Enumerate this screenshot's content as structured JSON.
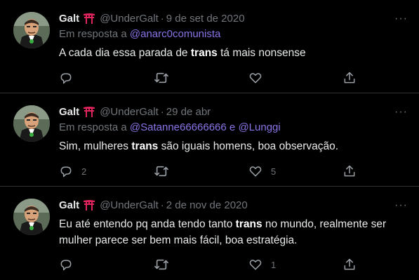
{
  "colors": {
    "background": "#000000",
    "mention": "#8b74e6",
    "muted": "#71767b",
    "text": "#e7e9ea",
    "torii": "#e0245e"
  },
  "icons": [
    "torii-gate-icon",
    "reply-icon",
    "retweet-icon",
    "like-icon",
    "share-icon",
    "more-icon",
    "avatar-image"
  ],
  "tweets": [
    {
      "name": "Galt",
      "handle": "@UnderGalt",
      "dot": "·",
      "date": "9 de set de 2020",
      "reply_prefix": "Em resposta a",
      "mention1": "@anarc0comunista",
      "mention_join": "",
      "mention2": "",
      "text_before": "A cada dia essa parada de ",
      "text_bold": "trans",
      "text_after": " tá mais nonsense",
      "replies": "",
      "retweets": "",
      "likes": "",
      "more": "···"
    },
    {
      "name": "Galt",
      "handle": "@UnderGalt",
      "dot": "·",
      "date": "29 de abr",
      "reply_prefix": "Em resposta a",
      "mention1": "@Satanne66666666",
      "mention_join": " e ",
      "mention2": "@Lunggi",
      "text_before": "Sim, mulheres ",
      "text_bold": "trans",
      "text_after": " são iguais homens, boa observação.",
      "replies": "2",
      "retweets": "",
      "likes": "5",
      "more": "···"
    },
    {
      "name": "Galt",
      "handle": "@UnderGalt",
      "dot": "·",
      "date": "2 de nov de 2020",
      "reply_prefix": "",
      "mention1": "",
      "mention_join": "",
      "mention2": "",
      "text_before": "Eu até entendo pq anda tendo tanto ",
      "text_bold": "trans",
      "text_after": " no mundo, realmente ser mulher parece ser bem mais fácil, boa estratégia.",
      "replies": "",
      "retweets": "",
      "likes": "1",
      "more": "···"
    }
  ]
}
